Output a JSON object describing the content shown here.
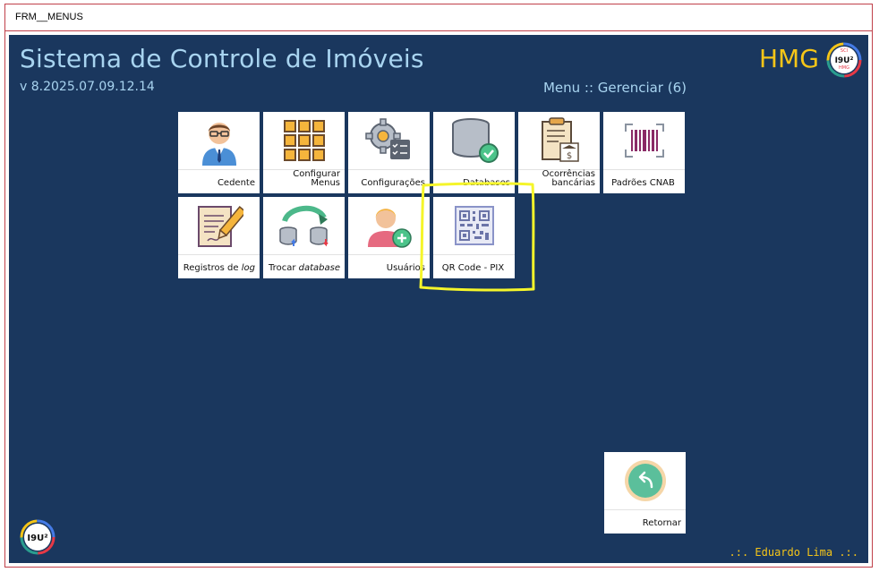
{
  "window": {
    "title": "FRM__MENUS"
  },
  "header": {
    "app_title": "Sistema de Controle de Imóveis",
    "version": "v 8.2025.07.09.12.14",
    "menu_path": "Menu ::  Gerenciar (6)",
    "env_label": "HMG",
    "logo_top_text": "I9U²",
    "logo_top_sub1": "SCI",
    "logo_top_sub2": "HMG"
  },
  "tiles": [
    {
      "label": "Cedente",
      "icon": "user-icon"
    },
    {
      "label_line1": "Configurar",
      "label_line2": "Menus",
      "icon": "grid-menu-icon"
    },
    {
      "label": "Configurações",
      "icon": "gear-checklist-icon"
    },
    {
      "label": "Databases",
      "icon": "database-check-icon"
    },
    {
      "label_line1": "Ocorrências",
      "label_line2": "bancárias",
      "icon": "bank-document-icon"
    },
    {
      "label": "Padrões CNAB",
      "icon": "barcode-icon"
    },
    {
      "label_prefix": "Registros de ",
      "label_em": "log",
      "icon": "document-pencil-icon"
    },
    {
      "label_prefix": "Trocar ",
      "label_em": "database",
      "icon": "swap-database-icon"
    },
    {
      "label": "Usuários",
      "icon": "add-user-icon"
    },
    {
      "label": "QR Code - PIX",
      "icon": "qr-code-icon"
    }
  ],
  "return_button": {
    "label": "Retornar",
    "icon": "back-arrow-icon"
  },
  "footer": {
    "logo_text": "I9U²",
    "user_name": ".:. Eduardo Lima .:."
  },
  "colors": {
    "background": "#1a375e",
    "title_text": "#a8d4f0",
    "accent_yellow": "#f5c518",
    "frame_border": "#c0404a"
  }
}
